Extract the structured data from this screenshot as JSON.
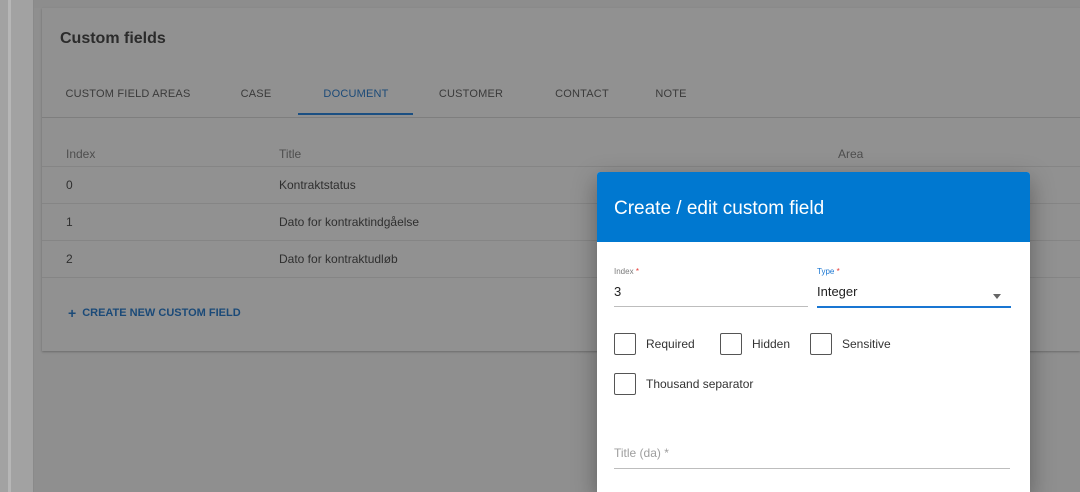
{
  "card": {
    "title": "Custom fields",
    "tabs": [
      {
        "label": "CUSTOM FIELD AREAS"
      },
      {
        "label": "CASE"
      },
      {
        "label": "DOCUMENT"
      },
      {
        "label": "CUSTOMER"
      },
      {
        "label": "CONTACT"
      },
      {
        "label": "NOTE"
      }
    ],
    "active_tab": "DOCUMENT",
    "table": {
      "headers": {
        "index": "Index",
        "title": "Title",
        "area": "Area"
      },
      "rows": [
        {
          "index": "0",
          "title": "Kontraktstatus"
        },
        {
          "index": "1",
          "title": "Dato for kontraktindgåelse"
        },
        {
          "index": "2",
          "title": "Dato for kontraktudløb"
        }
      ]
    },
    "create_link": {
      "icon": "plus-icon",
      "label": "CREATE NEW CUSTOM FIELD"
    }
  },
  "dialog": {
    "title": "Create / edit custom field",
    "index_field": {
      "label": "Index",
      "required_mark": "*",
      "value": "3"
    },
    "type_field": {
      "label": "Type",
      "required_mark": "*",
      "value": "Integer"
    },
    "checkboxes": [
      {
        "label": "Required",
        "checked": false
      },
      {
        "label": "Hidden",
        "checked": false
      },
      {
        "label": "Sensitive",
        "checked": false
      },
      {
        "label": "Thousand separator",
        "checked": false
      }
    ],
    "title_field": {
      "placeholder": "Title (da) *"
    }
  },
  "colors": {
    "dialog_header": "#0078d0",
    "accent": "#1976d2",
    "required": "#e53935"
  }
}
